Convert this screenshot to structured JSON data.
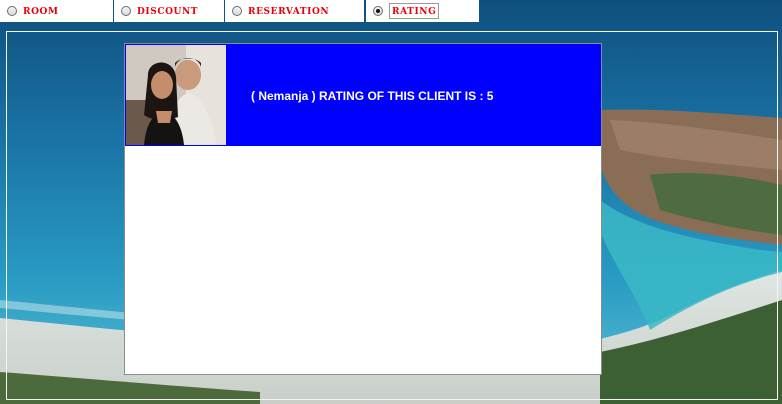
{
  "tabs": [
    {
      "label": "ROOM",
      "selected": false
    },
    {
      "label": "DISCOUNT",
      "selected": false
    },
    {
      "label": "RESERVATION",
      "selected": false
    },
    {
      "label": "RATING",
      "selected": true
    }
  ],
  "panel": {
    "rating_text": "( Nemanja ) RATING OF THIS CLIENT IS : 5"
  },
  "colors": {
    "tab_label": "#e8000b",
    "banner": "#0000ff"
  }
}
